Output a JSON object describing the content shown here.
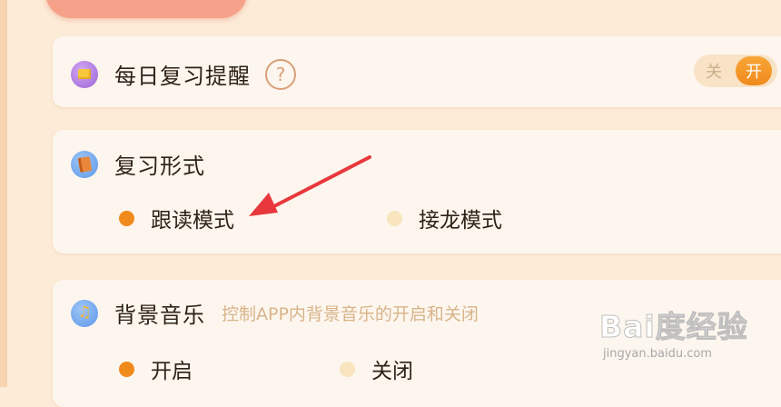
{
  "reminder": {
    "title": "每日复习提醒",
    "help_icon_glyph": "?",
    "toggle_off_label": "关",
    "toggle_on_label": "开",
    "state": "on"
  },
  "review_mode": {
    "title": "复习形式",
    "options": [
      {
        "label": "跟读模式",
        "selected": true
      },
      {
        "label": "接龙模式",
        "selected": false
      }
    ]
  },
  "music": {
    "title": "背景音乐",
    "subtitle": "控制APP内背景音乐的开启和关闭",
    "icon_glyph": "♫",
    "options": [
      {
        "label": "开启",
        "selected": true
      },
      {
        "label": "关闭",
        "selected": false
      }
    ]
  },
  "watermark": {
    "logo": "Bai度经验",
    "url": "jingyan.baidu.com"
  },
  "colors": {
    "accent": "#f08a1d",
    "background": "#fcebd7",
    "card": "#fdf6ee",
    "annotation_arrow": "#e8383d"
  },
  "icons": [
    "alarm-icon",
    "help-icon",
    "book-icon",
    "music-note-icon"
  ]
}
